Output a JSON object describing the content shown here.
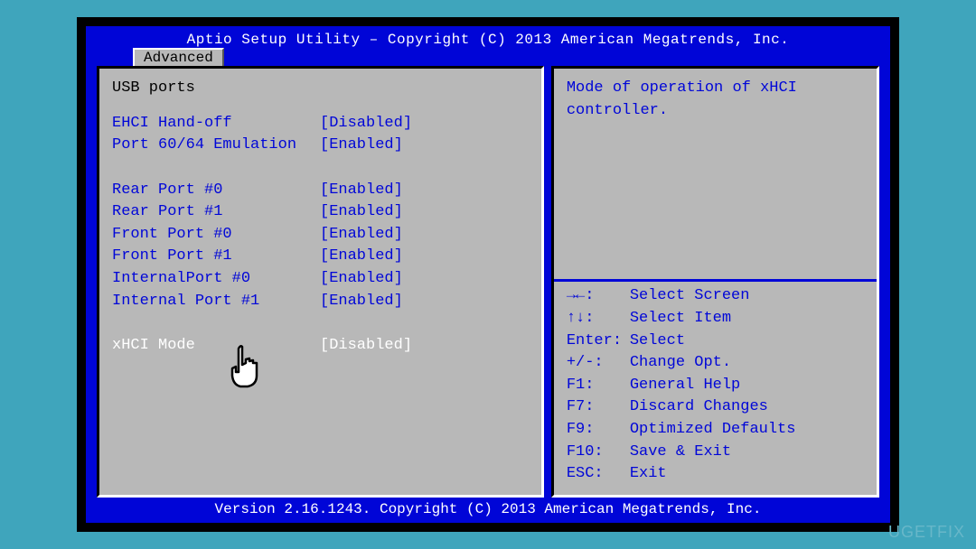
{
  "header": {
    "title": "Aptio Setup Utility – Copyright (C) 2013 American Megatrends, Inc."
  },
  "tab": {
    "label": "Advanced"
  },
  "left": {
    "section_title": "USB ports",
    "rows": [
      {
        "label": "EHCI Hand-off",
        "value": "[Disabled]",
        "selected": false
      },
      {
        "label": "Port 60/64 Emulation",
        "value": "[Enabled]",
        "selected": false
      },
      {
        "type": "blank"
      },
      {
        "label": "Rear Port #0",
        "value": "[Enabled]",
        "selected": false
      },
      {
        "label": "Rear Port #1",
        "value": "[Enabled]",
        "selected": false
      },
      {
        "label": "Front Port #0",
        "value": "[Enabled]",
        "selected": false
      },
      {
        "label": "Front Port #1",
        "value": "[Enabled]",
        "selected": false
      },
      {
        "label": "InternalPort #0",
        "value": "[Enabled]",
        "selected": false
      },
      {
        "label": "Internal Port #1",
        "value": "[Enabled]",
        "selected": false
      },
      {
        "type": "blank"
      },
      {
        "label": "xHCI Mode",
        "value": "[Disabled]",
        "selected": true
      }
    ]
  },
  "right": {
    "help_text": "Mode of operation of xHCI controller.",
    "keys": [
      {
        "sym": "→←:",
        "desc": "Select Screen"
      },
      {
        "sym": "↑↓:",
        "desc": "Select Item"
      },
      {
        "sym": "Enter:",
        "desc": "Select"
      },
      {
        "sym": "+/-:",
        "desc": "Change Opt."
      },
      {
        "sym": "F1:",
        "desc": "General Help"
      },
      {
        "sym": "F7:",
        "desc": "Discard Changes"
      },
      {
        "sym": "F9:",
        "desc": "Optimized Defaults"
      },
      {
        "sym": "F10:",
        "desc": "Save & Exit"
      },
      {
        "sym": "ESC:",
        "desc": "Exit"
      }
    ]
  },
  "footer": {
    "text": "Version 2.16.1243. Copyright (C) 2013 American Megatrends, Inc."
  },
  "watermark": "UGETFIX"
}
